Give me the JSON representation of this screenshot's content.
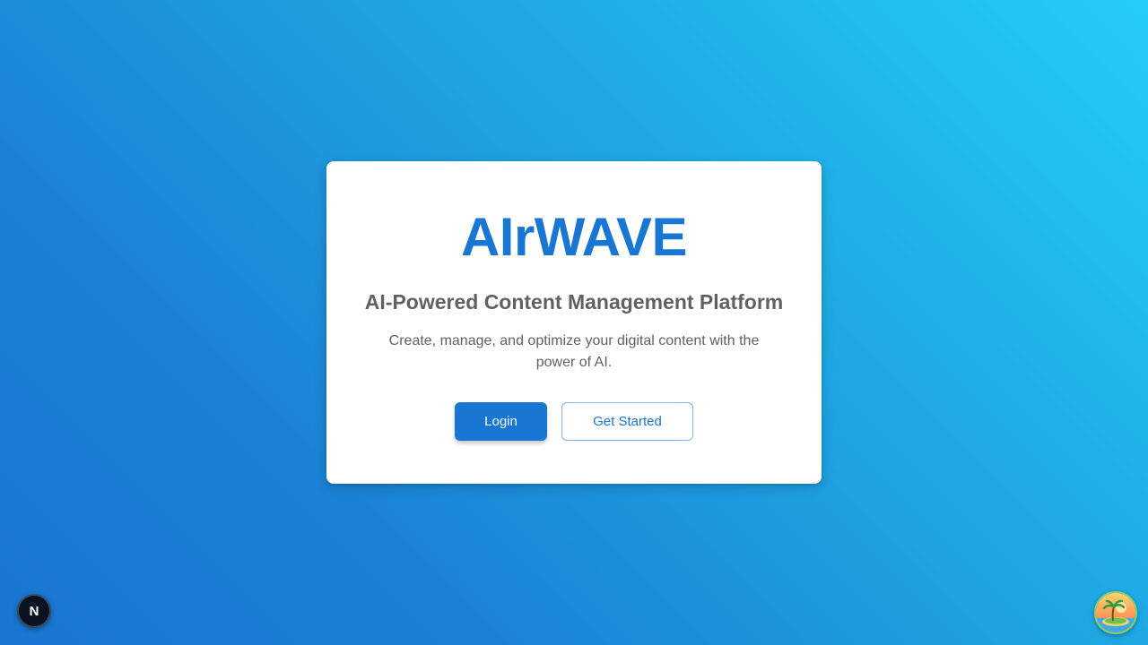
{
  "brand": {
    "title": "AIrWAVE",
    "color": "#1976d2"
  },
  "hero": {
    "subtitle": "AI-Powered Content Management Platform",
    "description": "Create, manage, and optimize your digital content with the power of AI."
  },
  "actions": {
    "login_label": "Login",
    "get_started_label": "Get Started"
  },
  "dev_indicator": {
    "label": "N",
    "icon": "nextjs-logo-icon"
  },
  "avatar": {
    "icon": "island-avatar-icon"
  },
  "colors": {
    "background_start": "#24cdf6",
    "background_end": "#1975d2",
    "primary": "#1976d2",
    "text_secondary": "#616161"
  }
}
